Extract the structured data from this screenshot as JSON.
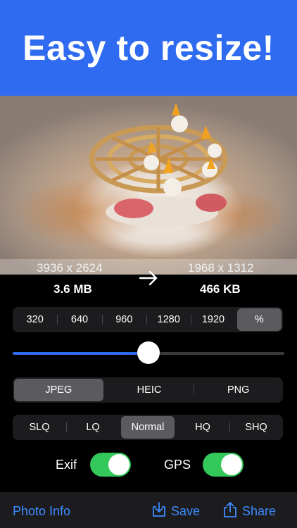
{
  "banner": {
    "title": "Easy to resize!"
  },
  "image_info": {
    "original_dims": "3936 x 2624",
    "new_dims": "1968 x 1312",
    "original_size": "3.6 MB",
    "new_size": "466 KB"
  },
  "size_presets": {
    "items": [
      "320",
      "640",
      "960",
      "1280",
      "1920",
      "%"
    ],
    "selected": "%"
  },
  "scale_slider": {
    "value": 0.5
  },
  "format": {
    "items": [
      "JPEG",
      "HEIC",
      "PNG"
    ],
    "selected": "JPEG"
  },
  "quality": {
    "items": [
      "SLQ",
      "LQ",
      "Normal",
      "HQ",
      "SHQ"
    ],
    "selected": "Normal"
  },
  "toggles": {
    "exif": {
      "label": "Exif",
      "on": true
    },
    "gps": {
      "label": "GPS",
      "on": true
    }
  },
  "toolbar": {
    "photo_info": "Photo Info",
    "save": "Save",
    "share": "Share"
  },
  "colors": {
    "accent": "#2f6bf0",
    "toggle_on": "#34c759",
    "link": "#3d8bff"
  },
  "icons": [
    "arrow-right-icon",
    "save-icon",
    "share-icon"
  ]
}
